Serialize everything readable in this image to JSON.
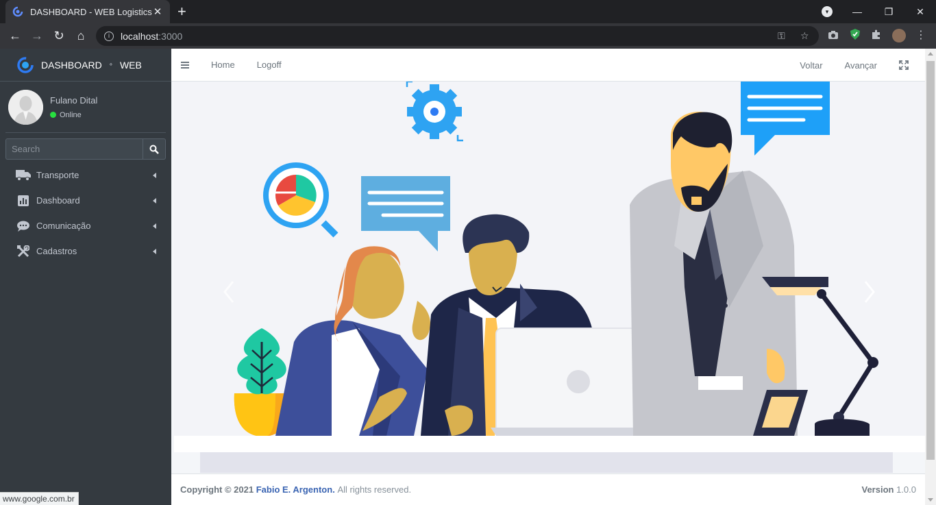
{
  "browser": {
    "tab_title": "DASHBOARD - WEB Logistics",
    "url_host": "localhost",
    "url_port": ":3000",
    "status_url": "www.google.com.br"
  },
  "sidebar": {
    "brand_main": "DASHBOARD",
    "brand_sub": "WEB",
    "user_name": "Fulano Dital",
    "user_status": "Online",
    "search_placeholder": "Search",
    "items": [
      {
        "label": "Transporte",
        "icon": "truck-icon"
      },
      {
        "label": "Dashboard",
        "icon": "chart-icon"
      },
      {
        "label": "Comunicação",
        "icon": "chat-icon"
      },
      {
        "label": "Cadastros",
        "icon": "tools-icon"
      }
    ]
  },
  "navbar": {
    "home": "Home",
    "logoff": "Logoff",
    "back": "Voltar",
    "forward": "Avançar"
  },
  "footer": {
    "copyright_prefix": "Copyright © 2021",
    "author": "Fabio E. Argenton.",
    "rights": "All rights reserved.",
    "version_label": "Version",
    "version_number": "1.0.0"
  },
  "colors": {
    "sidebar_bg": "#343a40",
    "accent_blue": "#2ea3f2",
    "online_green": "#28e040",
    "author_link": "#3a64b2"
  }
}
